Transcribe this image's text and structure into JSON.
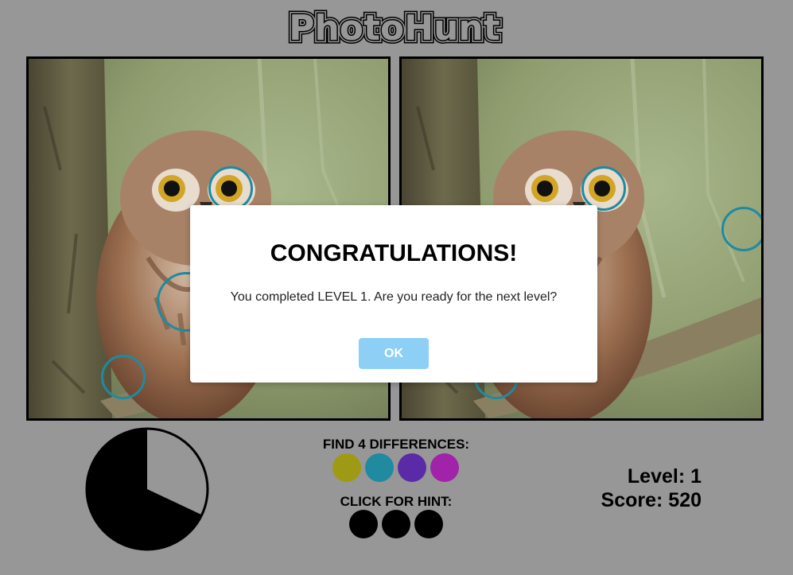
{
  "app": {
    "title": "PhotoHunt"
  },
  "game": {
    "find_label": "FIND 4 DIFFERENCES:",
    "hint_label": "CLICK FOR HINT:",
    "level_text": "Level: 1",
    "score_text": "Score: 520",
    "differences_total": 4,
    "difference_colors": [
      "#9e9a14",
      "#1f8aa0",
      "#5b2aa6",
      "#a023a9"
    ],
    "hints_remaining": 3,
    "hint_color": "#000000",
    "found_marker_color": "#1f8aa0",
    "timer_remaining_fraction": 0.68,
    "timer_elapsed_fraction": 0.32
  },
  "modal": {
    "title": "CONGRATULATIONS!",
    "message": "You completed LEVEL 1. Are you ready for the next level?",
    "ok_label": "OK"
  },
  "colors": {
    "background": "#979797",
    "ok_button": "#8ed0f5"
  }
}
